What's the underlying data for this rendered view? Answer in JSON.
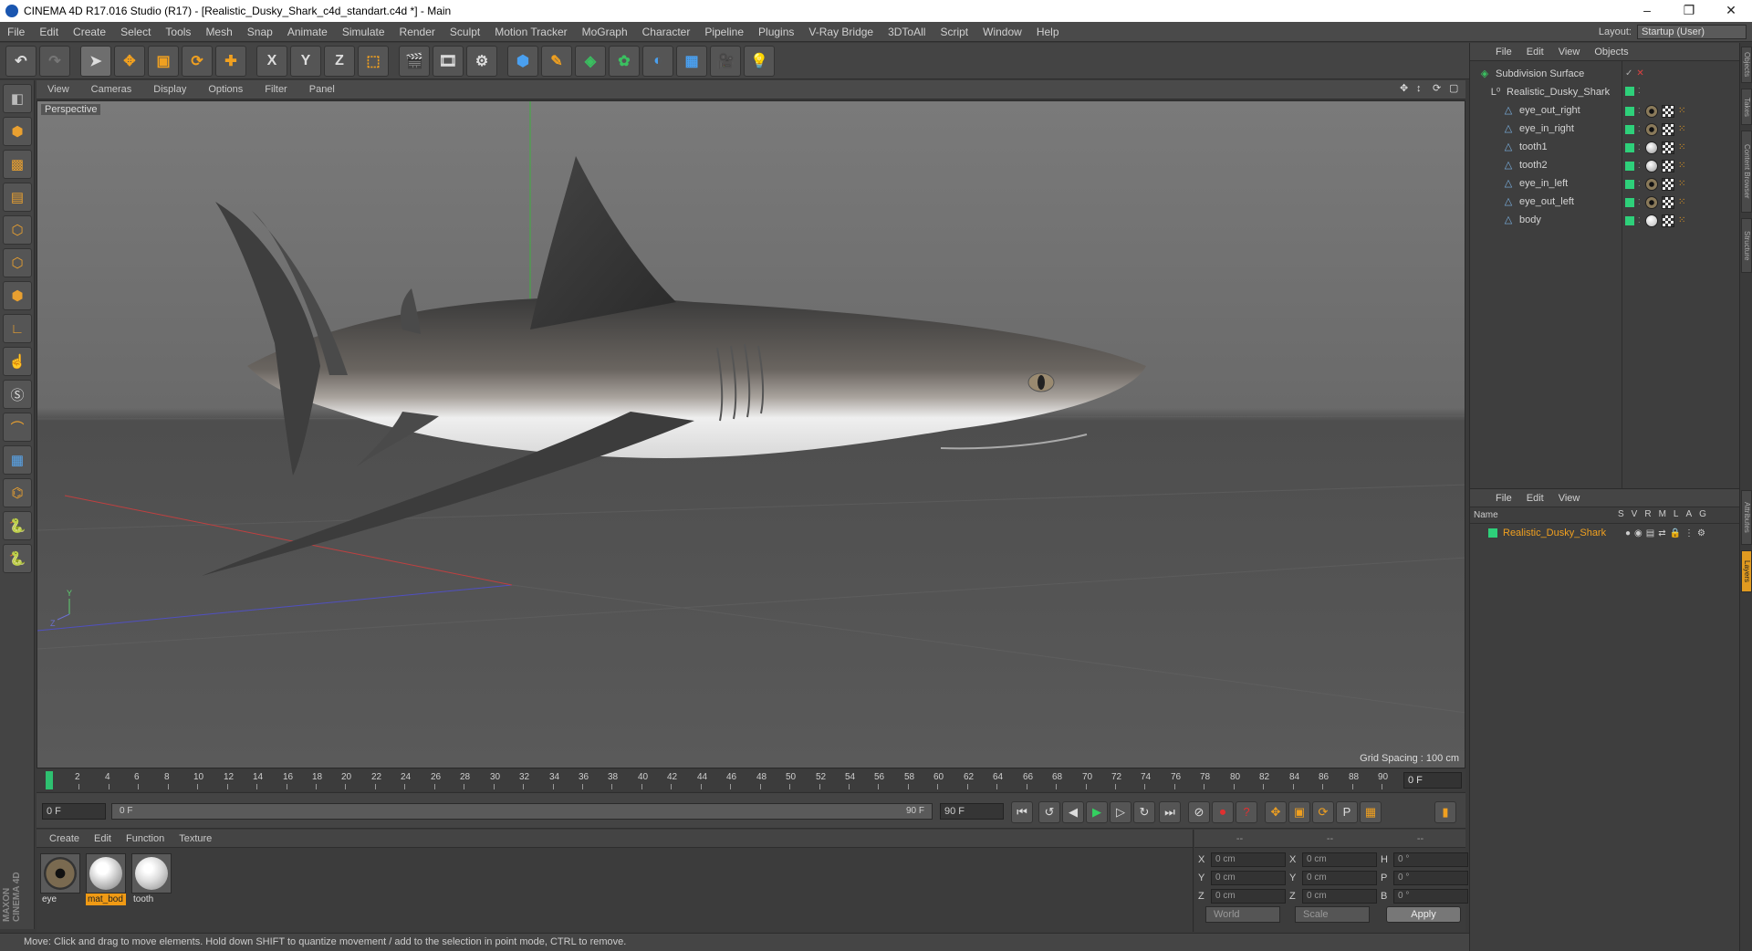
{
  "window": {
    "title": "CINEMA 4D R17.016 Studio (R17) - [Realistic_Dusky_Shark_c4d_standart.c4d *] - Main",
    "buttons": [
      "–",
      "❐",
      "✕"
    ]
  },
  "menubar": {
    "items": [
      "File",
      "Edit",
      "Create",
      "Select",
      "Tools",
      "Mesh",
      "Snap",
      "Animate",
      "Simulate",
      "Render",
      "Sculpt",
      "Motion Tracker",
      "MoGraph",
      "Character",
      "Pipeline",
      "Plugins",
      "V-Ray Bridge",
      "3DToAll",
      "Script",
      "Window",
      "Help"
    ],
    "layout_label": "Layout:",
    "layout_value": "Startup (User)"
  },
  "toolbar": {
    "axis_x": "X",
    "axis_y": "Y",
    "axis_z": "Z"
  },
  "viewport": {
    "menu": [
      "View",
      "Cameras",
      "Display",
      "Options",
      "Filter",
      "Panel"
    ],
    "label": "Perspective",
    "grid_spacing": "Grid Spacing : 100 cm"
  },
  "timeline": {
    "ticks": [
      "0",
      "2",
      "4",
      "6",
      "8",
      "10",
      "12",
      "14",
      "16",
      "18",
      "20",
      "22",
      "24",
      "26",
      "28",
      "30",
      "32",
      "34",
      "36",
      "38",
      "40",
      "42",
      "44",
      "46",
      "48",
      "50",
      "52",
      "54",
      "56",
      "58",
      "60",
      "62",
      "64",
      "66",
      "68",
      "70",
      "72",
      "74",
      "76",
      "78",
      "80",
      "82",
      "84",
      "86",
      "88",
      "90"
    ],
    "current_frame": "0 F"
  },
  "transport": {
    "start_field": "0 F",
    "range_start": "0 F",
    "range_end": "90 F",
    "end_field": "90 F"
  },
  "materials": {
    "menu": [
      "Create",
      "Edit",
      "Function",
      "Texture"
    ],
    "items": [
      {
        "name": "eye"
      },
      {
        "name": "mat_bod"
      },
      {
        "name": "tooth"
      }
    ]
  },
  "coordinates": {
    "head": [
      "--",
      "--",
      "--"
    ],
    "rows": [
      {
        "a": "X",
        "a_val": "0 cm",
        "b": "X",
        "b_val": "0 cm",
        "c": "H",
        "c_val": "0 °"
      },
      {
        "a": "Y",
        "a_val": "0 cm",
        "b": "Y",
        "b_val": "0 cm",
        "c": "P",
        "c_val": "0 °"
      },
      {
        "a": "Z",
        "a_val": "0 cm",
        "b": "Z",
        "b_val": "0 cm",
        "c": "B",
        "c_val": "0 °"
      }
    ],
    "space": "World",
    "mode": "Scale",
    "apply": "Apply"
  },
  "objects_panel": {
    "menu": [
      "File",
      "Edit",
      "View",
      "Objects"
    ],
    "items": [
      {
        "name": "Subdivision Surface",
        "level": 0
      },
      {
        "name": "Realistic_Dusky_Shark",
        "level": 1
      },
      {
        "name": "eye_out_right",
        "level": 2
      },
      {
        "name": "eye_in_right",
        "level": 2
      },
      {
        "name": "tooth1",
        "level": 2
      },
      {
        "name": "tooth2",
        "level": 2
      },
      {
        "name": "eye_in_left",
        "level": 2
      },
      {
        "name": "eye_out_left",
        "level": 2
      },
      {
        "name": "body",
        "level": 2
      }
    ]
  },
  "layers_panel": {
    "menu": [
      "File",
      "Edit",
      "View"
    ],
    "name_header": "Name",
    "columns": [
      "S",
      "V",
      "R",
      "M",
      "L",
      "A",
      "G"
    ],
    "items": [
      {
        "name": "Realistic_Dusky_Shark"
      }
    ]
  },
  "right_tabs": [
    "Objects",
    "Takes",
    "Content Browser",
    "Structure",
    "Attributes",
    "Layers"
  ],
  "status": "Move: Click and drag to move elements. Hold down SHIFT to quantize movement / add to the selection in point mode, CTRL to remove.",
  "colors": {
    "accent": "#f09a14",
    "layer_green": "#2ed07a",
    "playhead": "#2ec070"
  }
}
